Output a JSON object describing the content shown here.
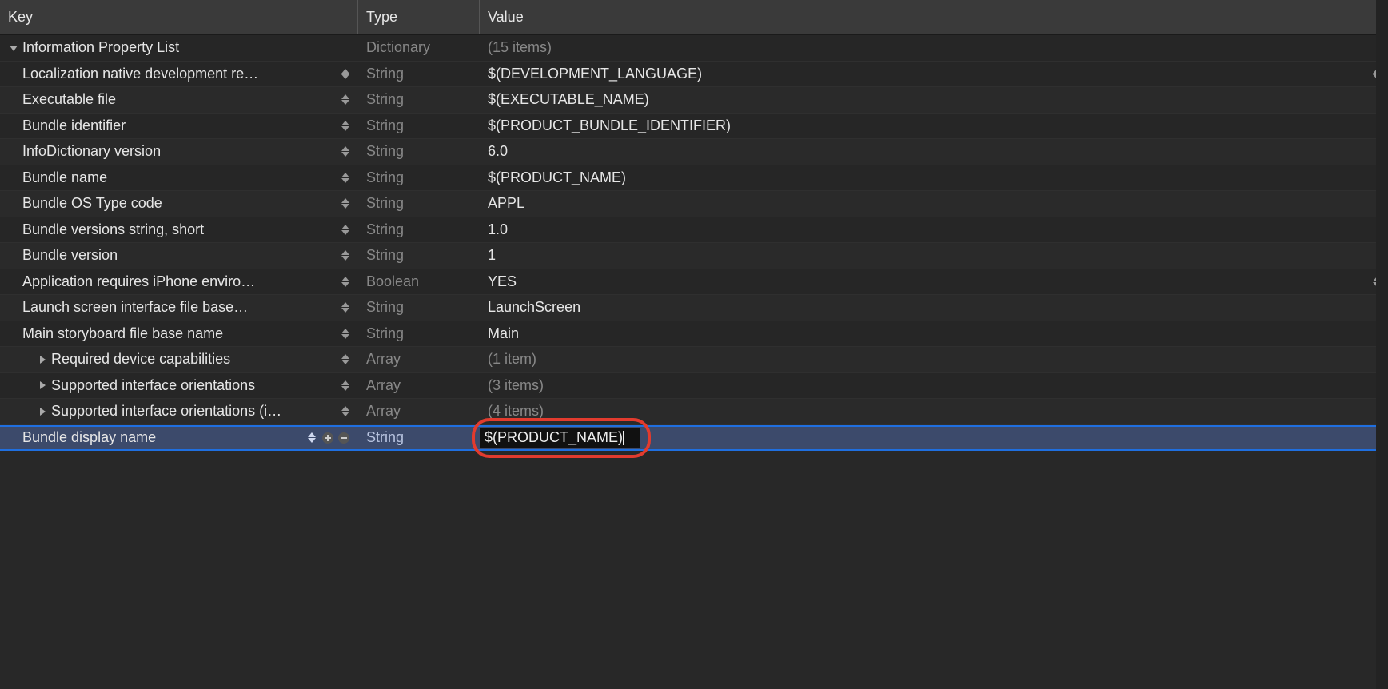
{
  "header": {
    "key": "Key",
    "type": "Type",
    "value": "Value"
  },
  "root": {
    "key": "Information Property List",
    "type": "Dictionary",
    "value": "(15 items)"
  },
  "rows": [
    {
      "key": "Localization native development re…",
      "type": "String",
      "value": "$(DEVELOPMENT_LANGUAGE)",
      "valStepper": true
    },
    {
      "key": "Executable file",
      "type": "String",
      "value": "$(EXECUTABLE_NAME)"
    },
    {
      "key": "Bundle identifier",
      "type": "String",
      "value": "$(PRODUCT_BUNDLE_IDENTIFIER)"
    },
    {
      "key": "InfoDictionary version",
      "type": "String",
      "value": "6.0"
    },
    {
      "key": "Bundle name",
      "type": "String",
      "value": "$(PRODUCT_NAME)"
    },
    {
      "key": "Bundle OS Type code",
      "type": "String",
      "value": "APPL"
    },
    {
      "key": "Bundle versions string, short",
      "type": "String",
      "value": "1.0"
    },
    {
      "key": "Bundle version",
      "type": "String",
      "value": "1"
    },
    {
      "key": "Application requires iPhone enviro…",
      "type": "Boolean",
      "value": "YES",
      "valStepper": true
    },
    {
      "key": "Launch screen interface file base…",
      "type": "String",
      "value": "LaunchScreen"
    },
    {
      "key": "Main storyboard file base name",
      "type": "String",
      "value": "Main"
    },
    {
      "key": "Required device capabilities",
      "type": "Array",
      "value": "(1 item)",
      "expandable": true
    },
    {
      "key": "Supported interface orientations",
      "type": "Array",
      "value": "(3 items)",
      "expandable": true
    },
    {
      "key": "Supported interface orientations (i…",
      "type": "Array",
      "value": "(4 items)",
      "expandable": true
    }
  ],
  "selected": {
    "key": "Bundle display name",
    "type": "String",
    "value": "$(PRODUCT_NAME)"
  },
  "annotation_target": "value-edit-field",
  "icons": {
    "chevron_up": "chevron-up-icon",
    "chevron_down": "chevron-down-icon",
    "triangle_down": "disclosure-open-icon",
    "triangle_right": "disclosure-closed-icon",
    "plus_circle": "add-icon",
    "minus_circle": "remove-icon"
  },
  "colors": {
    "selection_border": "#1f6fe0",
    "selection_fill": "#3c4a6b",
    "annotation": "#e23b2e",
    "text_secondary": "#888888"
  }
}
